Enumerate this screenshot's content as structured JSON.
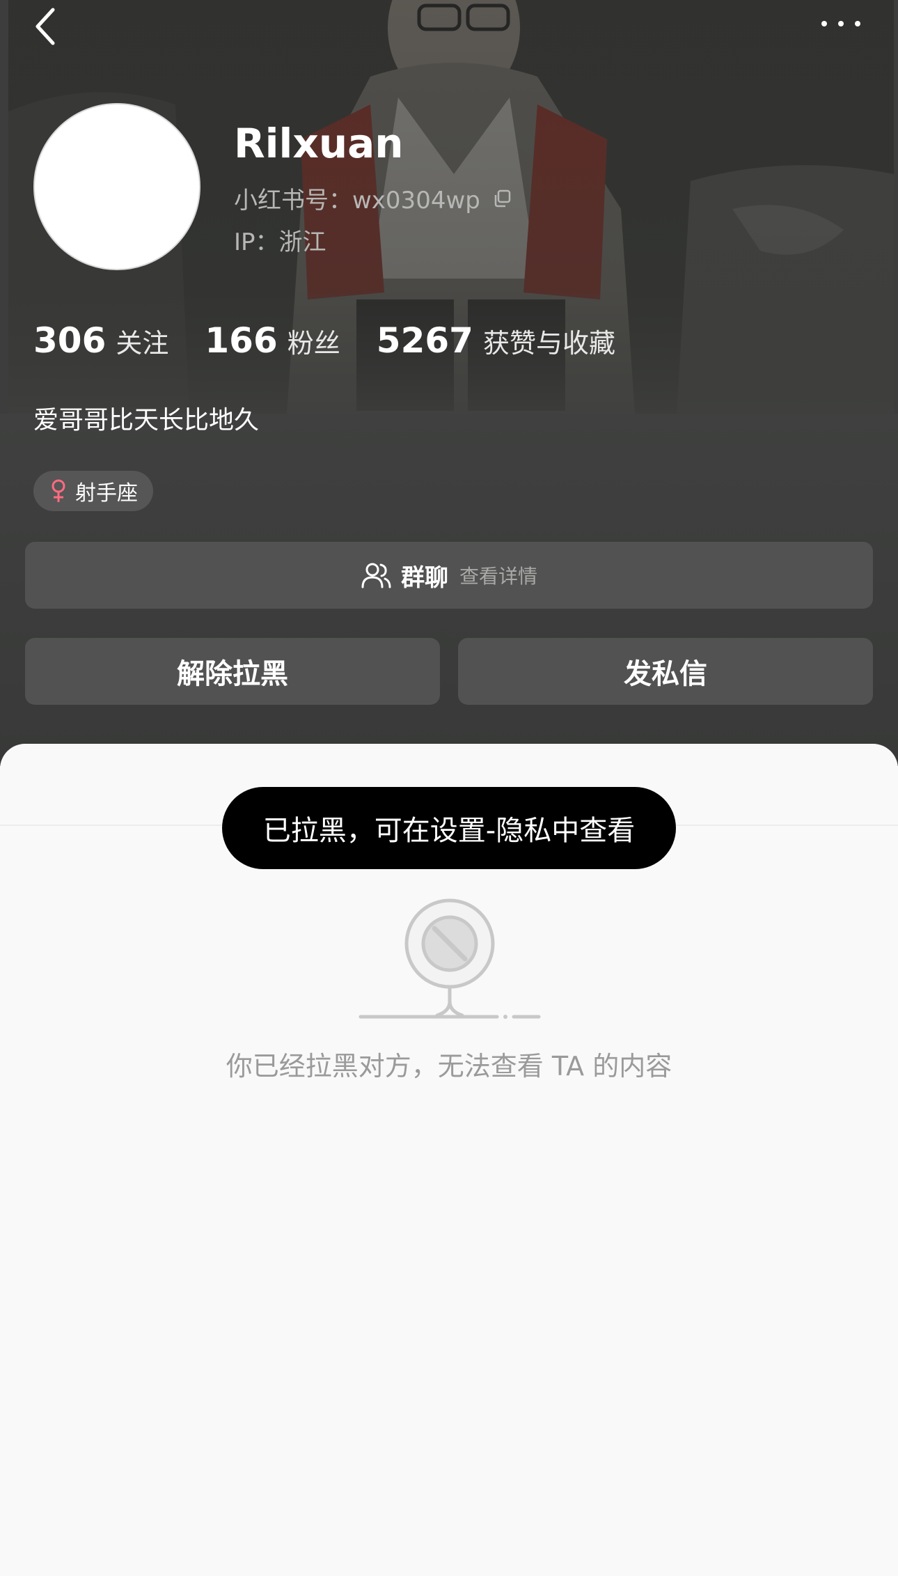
{
  "header": {
    "nickname": "Rilxuan",
    "red_id": "小红书号：wx0304wp",
    "ip": "IP：浙江",
    "bio": "爱哥哥比天长比地久",
    "tag": "射手座"
  },
  "stats": [
    {
      "value": "306",
      "label": "关注"
    },
    {
      "value": "166",
      "label": "粉丝"
    },
    {
      "value": "5267",
      "label": "获赞与收藏"
    }
  ],
  "group_chat": {
    "title": "群聊",
    "subtitle": "查看详情"
  },
  "actions": {
    "unblock": "解除拉黑",
    "message": "发私信"
  },
  "toast": "已拉黑，可在设置-隐私中查看",
  "empty_state": {
    "text": "你已经拉黑对方，无法查看 TA 的内容"
  },
  "icons": {
    "back": "chevron-left-icon",
    "more": "more-dots-icon",
    "copy": "copy-icon",
    "gender": "female-icon",
    "group": "group-people-icon",
    "empty": "blocked-illustration"
  },
  "colors": {
    "header_bg": "#3c3d3c",
    "button_bg": "#515251",
    "gender_accent": "#ff6b81",
    "sheet_bg": "#f9f9f9",
    "toast_bg": "#000000"
  }
}
